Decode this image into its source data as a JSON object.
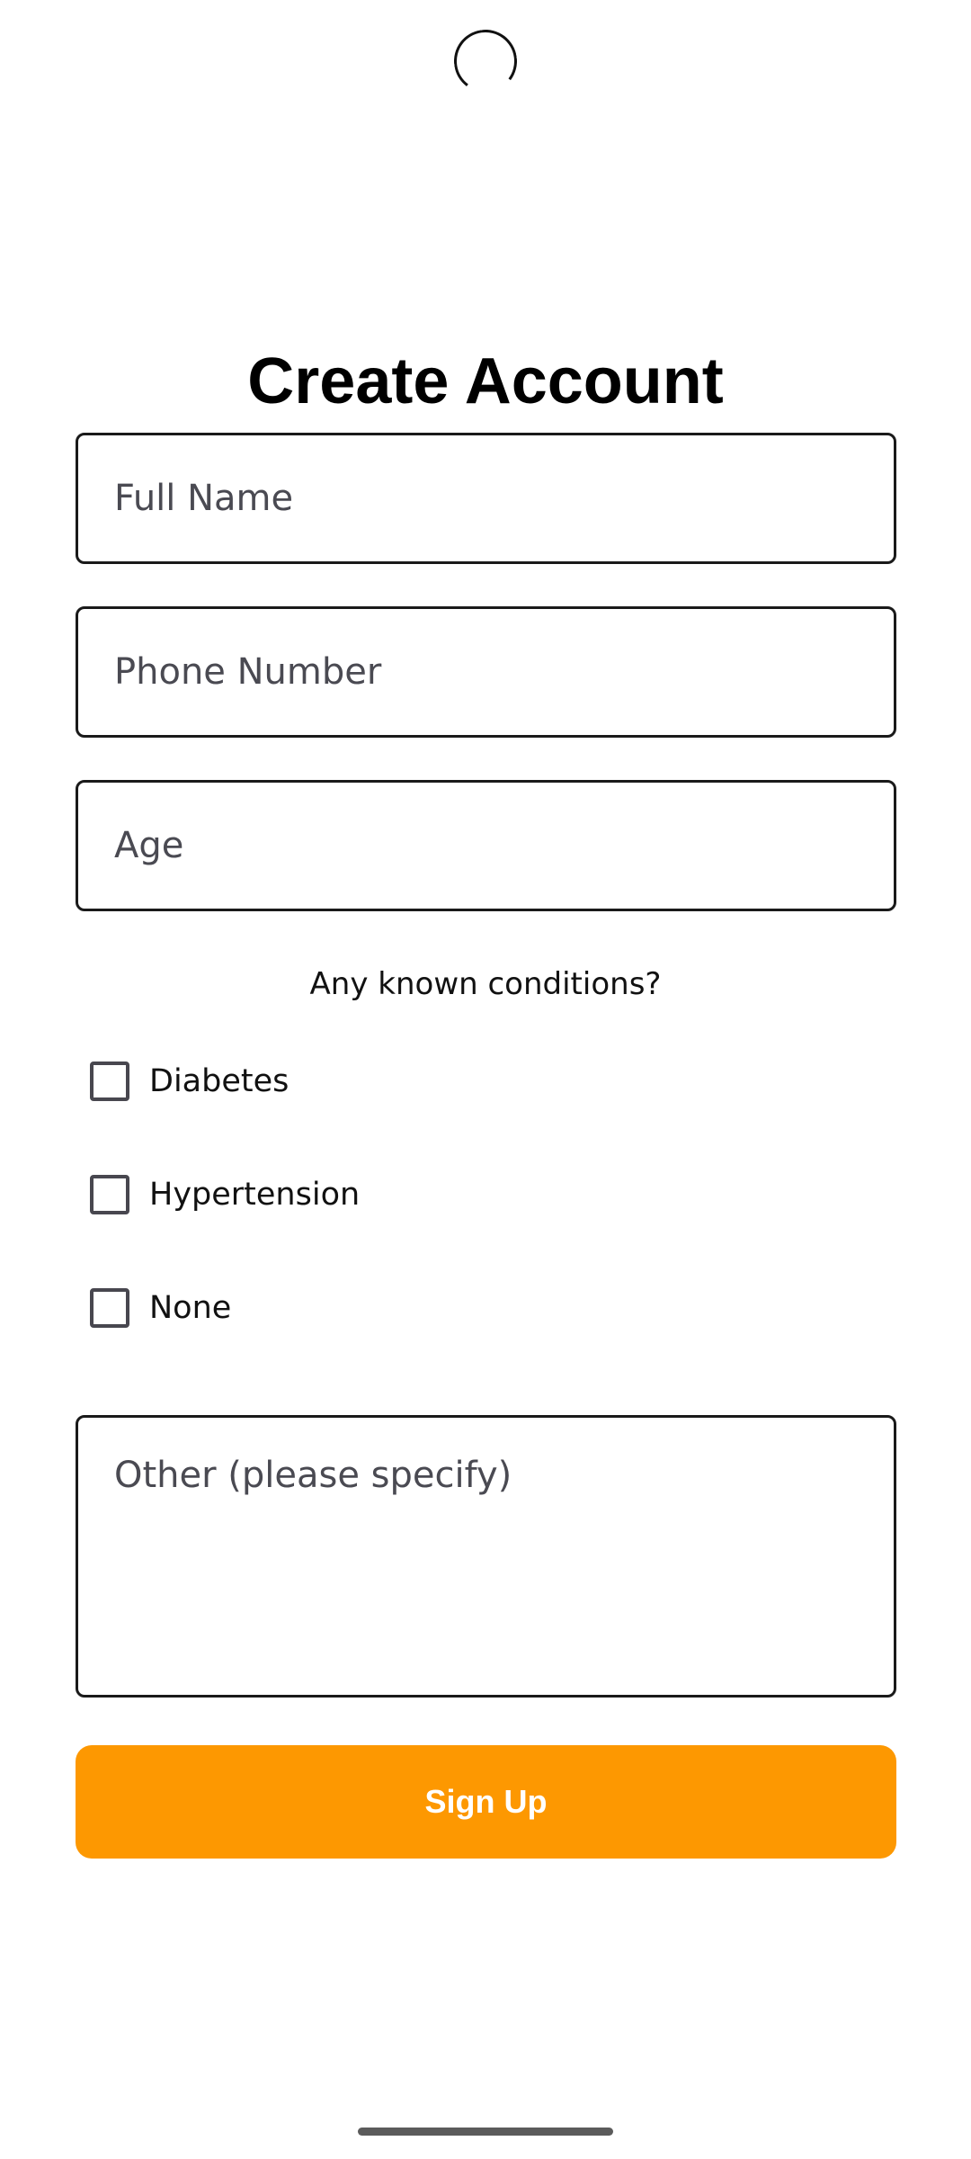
{
  "title": "Create Account",
  "fields": {
    "full_name": {
      "placeholder": "Full Name",
      "value": ""
    },
    "phone_number": {
      "placeholder": "Phone Number",
      "value": ""
    },
    "age": {
      "placeholder": "Age",
      "value": ""
    },
    "other": {
      "placeholder": "Other (please specify)",
      "value": ""
    }
  },
  "conditions": {
    "question": "Any known conditions?",
    "options": [
      {
        "label": "Diabetes",
        "checked": false
      },
      {
        "label": "Hypertension",
        "checked": false
      },
      {
        "label": "None",
        "checked": false
      }
    ]
  },
  "signup_label": "Sign Up",
  "colors": {
    "accent": "#fd9801",
    "field_border": "#1a1a1a",
    "placeholder": "#4a4a52"
  }
}
